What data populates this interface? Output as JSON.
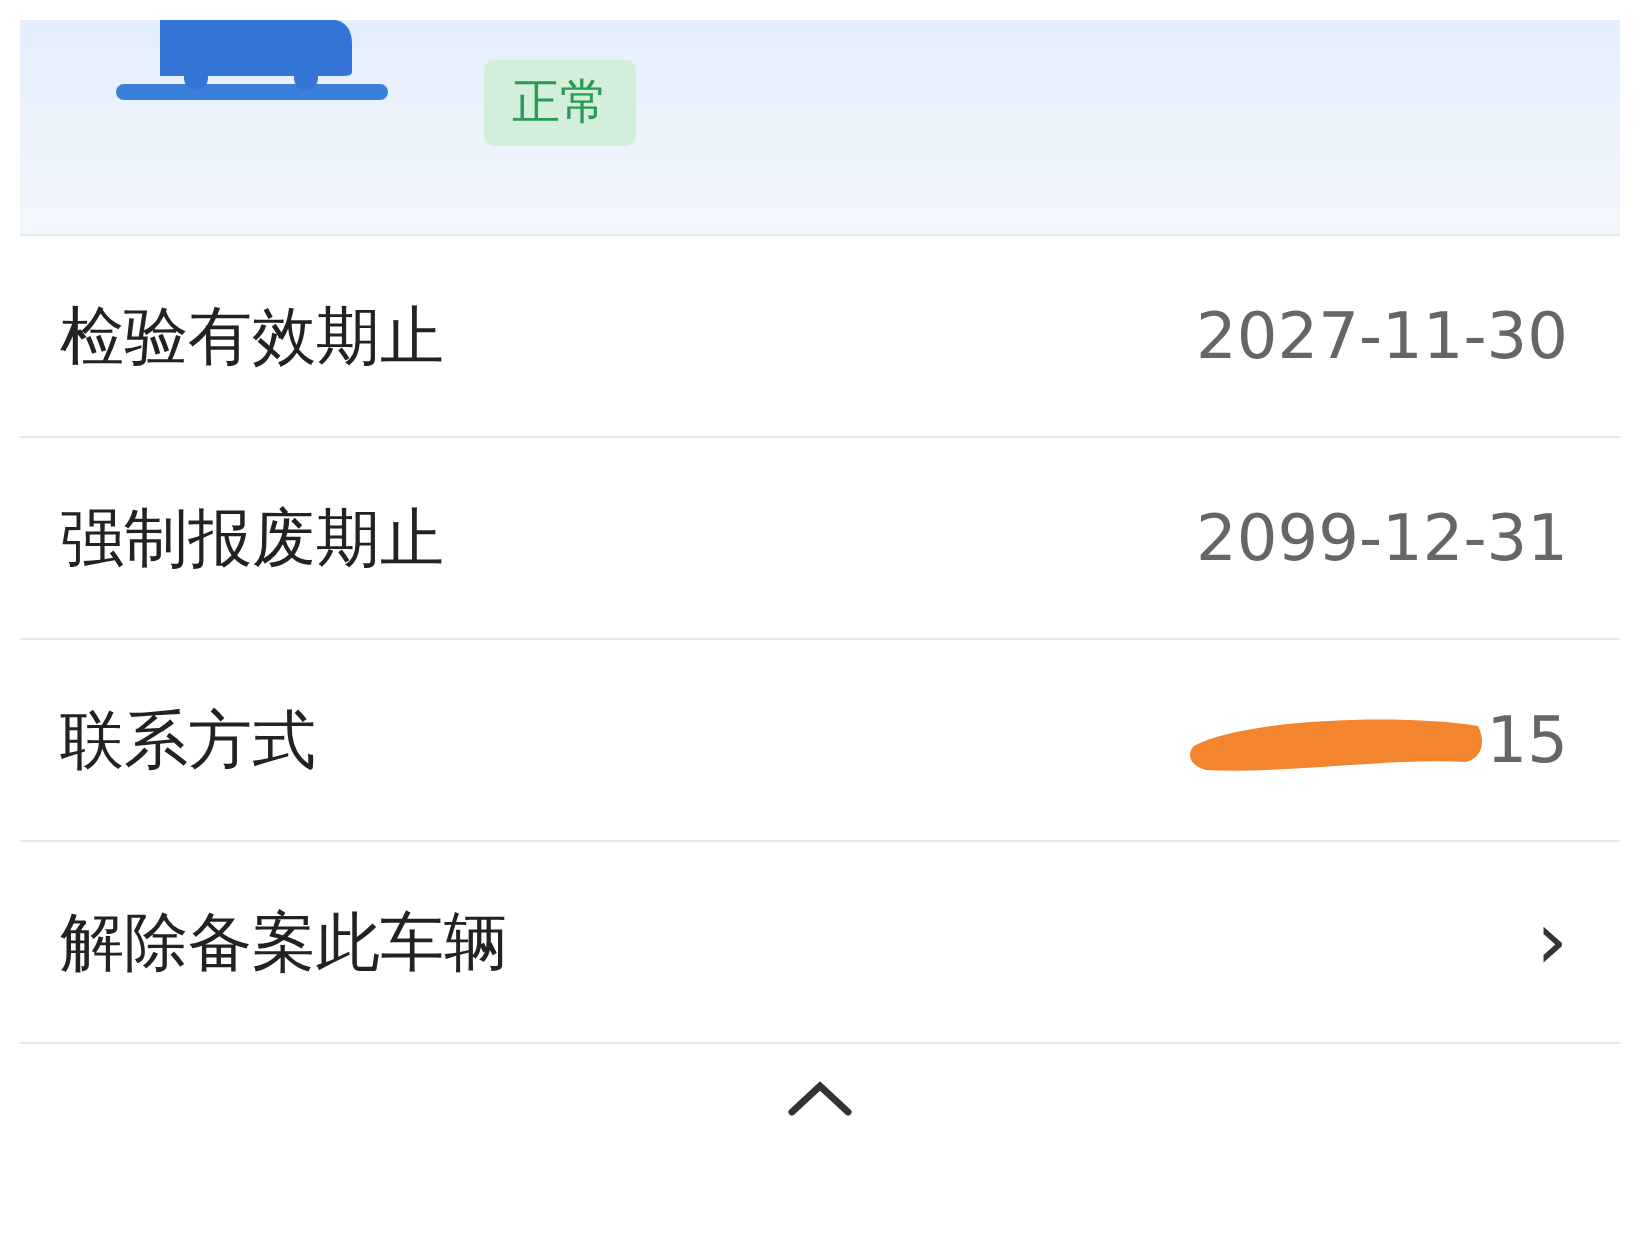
{
  "header": {
    "status_badge": "正常"
  },
  "rows": [
    {
      "kind": "value",
      "label": "检验有效期止",
      "value": "2027-11-30"
    },
    {
      "kind": "value",
      "label": "强制报废期止",
      "value": "2099-12-31"
    },
    {
      "kind": "redacted",
      "label": "联系方式",
      "value": "15"
    },
    {
      "kind": "link",
      "label": "解除备案此车辆",
      "value": "›"
    }
  ]
}
